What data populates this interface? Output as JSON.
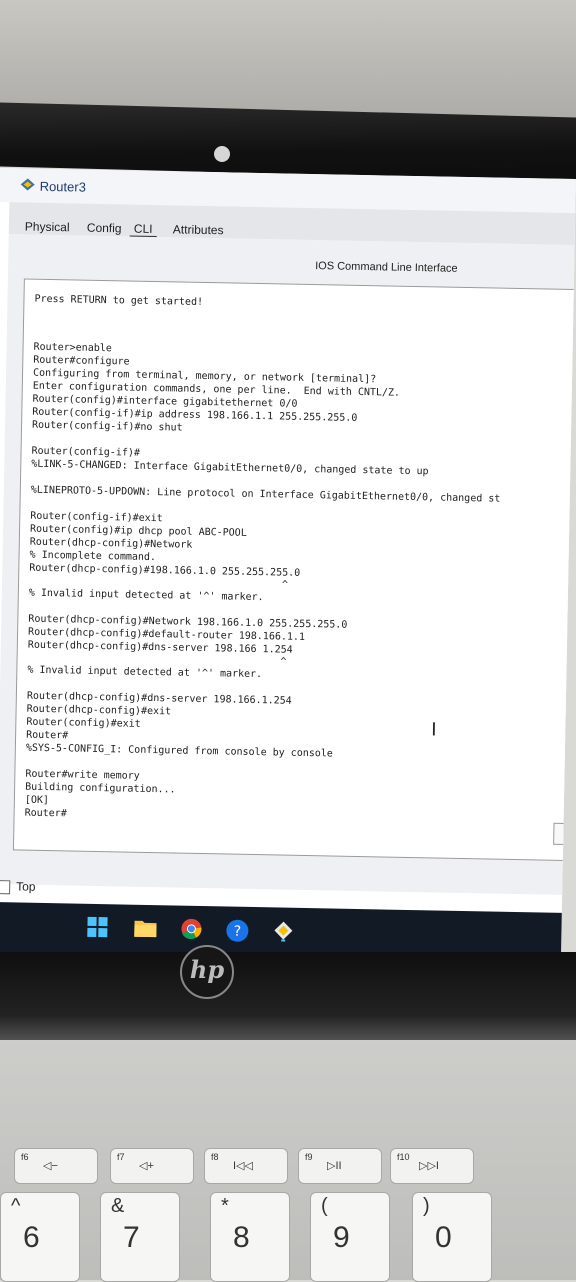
{
  "window": {
    "title": "Router3"
  },
  "tabs": [
    {
      "label": "Physical"
    },
    {
      "label": "Config"
    },
    {
      "label": "CLI"
    },
    {
      "label": "Attributes"
    }
  ],
  "panel_title": "IOS Command Line Interface",
  "console_lines": [
    "Press RETURN to get started!",
    "Router>enable",
    "Router#configure",
    "Configuring from terminal, memory, or network [terminal]?",
    "Enter configuration commands, one per line.  End with CNTL/Z.",
    "Router(config)#interface gigabitethernet 0/0",
    "Router(config-if)#ip address 198.166.1.1 255.255.255.0",
    "Router(config-if)#no shut",
    "Router(config-if)#",
    "%LINK-5-CHANGED: Interface GigabitEthernet0/0, changed state to up",
    "%LINEPROTO-5-UPDOWN: Line protocol on Interface GigabitEthernet0/0, changed st",
    "Router(config-if)#exit",
    "Router(config)#ip dhcp pool ABC-POOL",
    "Router(dhcp-config)#Network",
    "% Incomplete command.",
    "Router(dhcp-config)#198.166.1.0 255.255.255.0",
    "                                          ^",
    "% Invalid input detected at '^' marker.",
    "Router(dhcp-config)#Network 198.166.1.0 255.255.255.0",
    "Router(dhcp-config)#default-router 198.166.1.1",
    "Router(dhcp-config)#dns-server 198.166 1.254",
    "                                          ^",
    "% Invalid input detected at '^' marker.",
    "Router(dhcp-config)#dns-server 198.166.1.254",
    "Router(dhcp-config)#exit",
    "Router(config)#exit",
    "Router#",
    "%SYS-5-CONFIG_I: Configured from console by console",
    "Router#write memory",
    "Building configuration...",
    "[OK]",
    "Router#"
  ],
  "top_checkbox_label": "Top",
  "taskbar_icons": [
    "windows-icon",
    "file-explorer-icon",
    "chrome-icon",
    "help-icon",
    "packet-tracer-icon"
  ],
  "laptop": {
    "logo": "hp",
    "fkeys": [
      {
        "num": "f6",
        "sym": "◁−"
      },
      {
        "num": "f7",
        "sym": "◁+"
      },
      {
        "num": "f8",
        "sym": "I◁◁"
      },
      {
        "num": "f9",
        "sym": "▷II"
      },
      {
        "num": "f10",
        "sym": "▷▷I"
      }
    ],
    "numkeys": [
      {
        "top": "^",
        "main": "6"
      },
      {
        "top": "&",
        "main": "7"
      },
      {
        "top": "*",
        "main": "8"
      },
      {
        "top": "(",
        "main": "9"
      },
      {
        "top": ")",
        "main": "0"
      }
    ]
  },
  "colors": {
    "title_text": "#1f3b73",
    "taskbar": "#121a26",
    "console_bg": "#ffffff"
  }
}
